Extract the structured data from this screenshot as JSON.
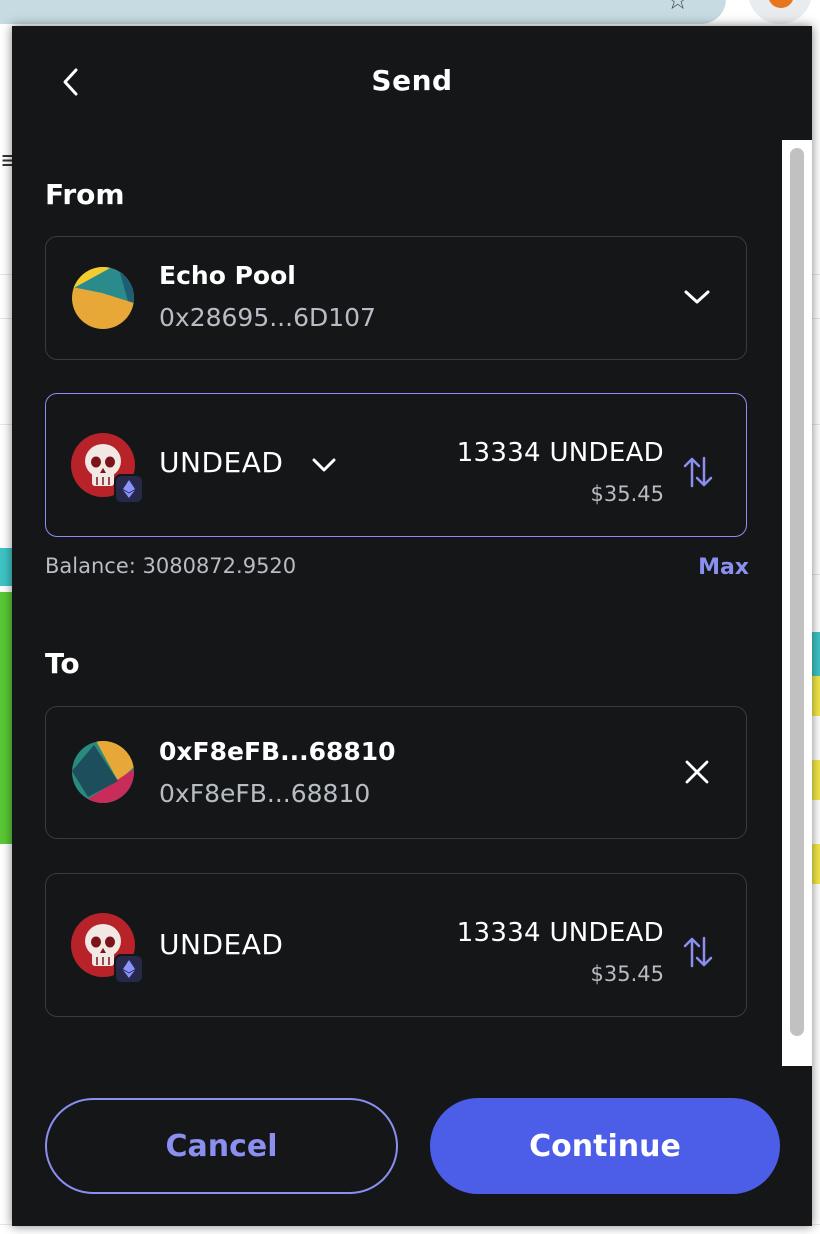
{
  "popup": {
    "title": "Send",
    "from_label": "From",
    "to_label": "To",
    "from_account": {
      "name": "Echo Pool",
      "address": "0x28695...6D107"
    },
    "send_token": {
      "symbol": "UNDEAD",
      "amount": "13334 UNDEAD",
      "fiat": "$35.45"
    },
    "balance": "Balance: 3080872.9520",
    "max_label": "Max",
    "to_account": {
      "name": "0xF8eFB...68810",
      "address": "0xF8eFB...68810"
    },
    "receive_token": {
      "symbol": "UNDEAD",
      "amount": "13334 UNDEAD",
      "fiat": "$35.45"
    },
    "cancel_label": "Cancel",
    "continue_label": "Continue"
  },
  "colors": {
    "background": "#141618",
    "accent": "#8a8ff0",
    "primary_button": "#4c5de8",
    "muted_text": "#b8bcc4",
    "card_border": "#383c42"
  },
  "icons": [
    "back-chevron-icon",
    "chevron-down-icon",
    "swap-icon",
    "close-icon",
    "skull-token-icon",
    "ethereum-icon",
    "star-icon",
    "extension-icon"
  ]
}
